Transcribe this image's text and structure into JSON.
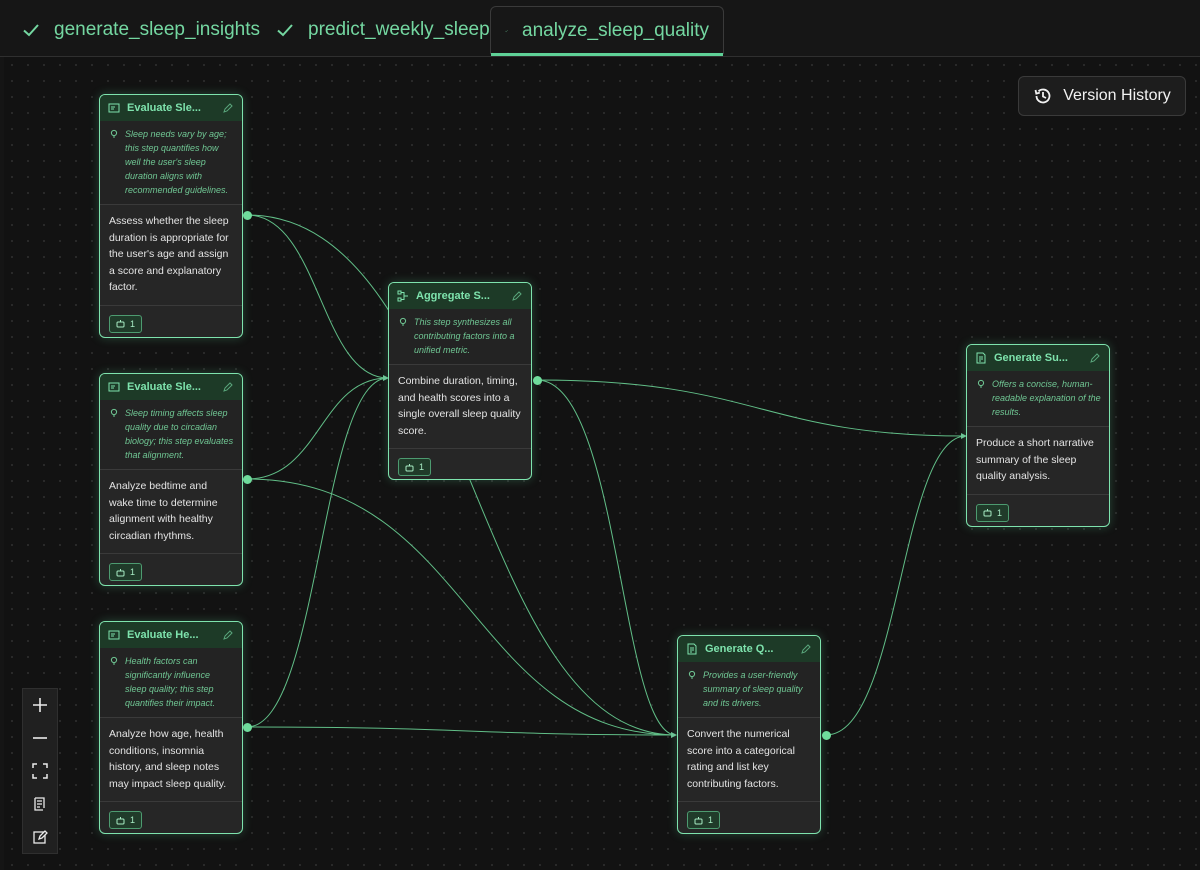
{
  "tabs": [
    {
      "label": "generate_sleep_insights",
      "status_icon": "check-icon",
      "active": false
    },
    {
      "label": "predict_weekly_sleep",
      "status_icon": "check-icon",
      "active": false
    },
    {
      "label": "analyze_sleep_quality",
      "status_icon": "check-icon",
      "active": true
    }
  ],
  "toolbar": {
    "version_history_label": "Version History",
    "icon": "history-icon"
  },
  "nodes": [
    {
      "id": "eval_duration",
      "title": "Evaluate Sle...",
      "icon": "module-icon",
      "note": "Sleep needs vary by age; this step quantifies how well the user's sleep duration aligns with recommended guidelines.",
      "description": "Assess whether the sleep duration is appropriate for the user's age and assign a score and explanatory factor.",
      "agent_count": "1"
    },
    {
      "id": "eval_timing",
      "title": "Evaluate Sle...",
      "icon": "module-icon",
      "note": "Sleep timing affects sleep quality due to circadian biology; this step evaluates that alignment.",
      "description": "Analyze bedtime and wake time to determine alignment with healthy circadian rhythms.",
      "agent_count": "1"
    },
    {
      "id": "eval_health",
      "title": "Evaluate He...",
      "icon": "module-icon",
      "note": "Health factors can significantly influence sleep quality; this step quantifies their impact.",
      "description": "Analyze how age, health conditions, insomnia history, and sleep notes may impact sleep quality.",
      "agent_count": "1"
    },
    {
      "id": "aggregate",
      "title": "Aggregate S...",
      "icon": "aggregate-icon",
      "note": "This step synthesizes all contributing factors into a unified metric.",
      "description": "Combine duration, timing, and health scores into a single overall sleep quality score.",
      "agent_count": "1"
    },
    {
      "id": "gen_quality",
      "title": "Generate Q...",
      "icon": "document-icon",
      "note": "Provides a user-friendly summary of sleep quality and its drivers.",
      "description": "Convert the numerical score into a categorical rating and list key contributing factors.",
      "agent_count": "1"
    },
    {
      "id": "gen_summary",
      "title": "Generate Su...",
      "icon": "document-icon",
      "note": "Offers a concise, human-readable explanation of the results.",
      "description": "Produce a short narrative summary of the sleep quality analysis.",
      "agent_count": "1"
    }
  ],
  "zoom_controls": [
    "zoom-in-icon",
    "zoom-out-icon",
    "fit-view-icon",
    "script-icon",
    "edit-icon"
  ],
  "colors": {
    "accent": "#7ee3ad",
    "header_bg": "#1d3a27",
    "node_bg": "#262626",
    "canvas_bg": "#121212",
    "edge": "#6fdc9c"
  }
}
